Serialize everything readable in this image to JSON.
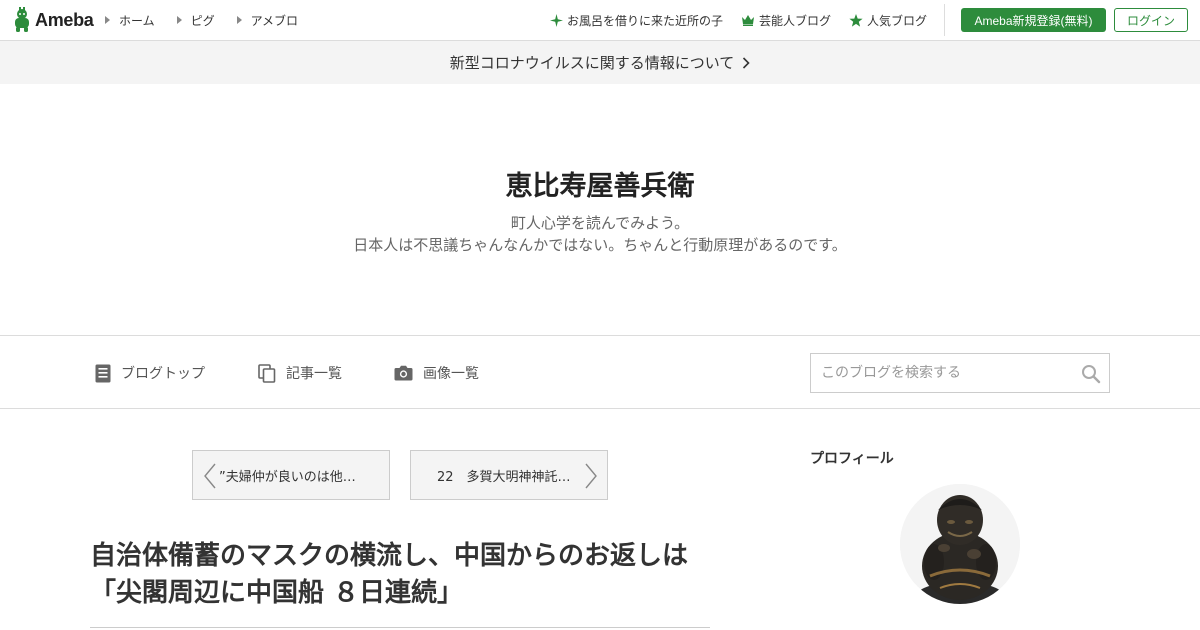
{
  "header": {
    "logo_text": "Ameba",
    "nav_left": [
      "ホーム",
      "ピグ",
      "アメブロ"
    ],
    "nav_right": [
      {
        "icon": "sparkle-icon",
        "label": "お風呂を借りに来た近所の子"
      },
      {
        "icon": "crown-icon",
        "label": "芸能人ブログ"
      },
      {
        "icon": "star-icon",
        "label": "人気ブログ"
      }
    ],
    "register_label": "Ameba新規登録(無料)",
    "login_label": "ログイン"
  },
  "notice": {
    "text": "新型コロナウイルスに関する情報について"
  },
  "blog": {
    "title": "恵比寿屋善兵衛",
    "description_line1": "町人心学を読んでみよう。",
    "description_line2": "日本人は不思議ちゃんなんかではない。ちゃんと行動原理があるのです。"
  },
  "blog_nav": {
    "items": [
      "ブログトップ",
      "記事一覧",
      "画像一覧"
    ],
    "search_placeholder": "このブログを検索する"
  },
  "pager": {
    "prev_label": "”夫婦仲が良いのは他…",
    "next_label": "22　多賀大明神神託…"
  },
  "article": {
    "title_line1": "自治体備蓄のマスクの横流し、中国からのお返しは",
    "title_line2": "「尖閣周辺に中国船 ８日連続」"
  },
  "sidebar": {
    "profile_heading": "プロフィール"
  },
  "colors": {
    "brand_green": "#2d8c3c",
    "border": "#dcdcdc"
  }
}
